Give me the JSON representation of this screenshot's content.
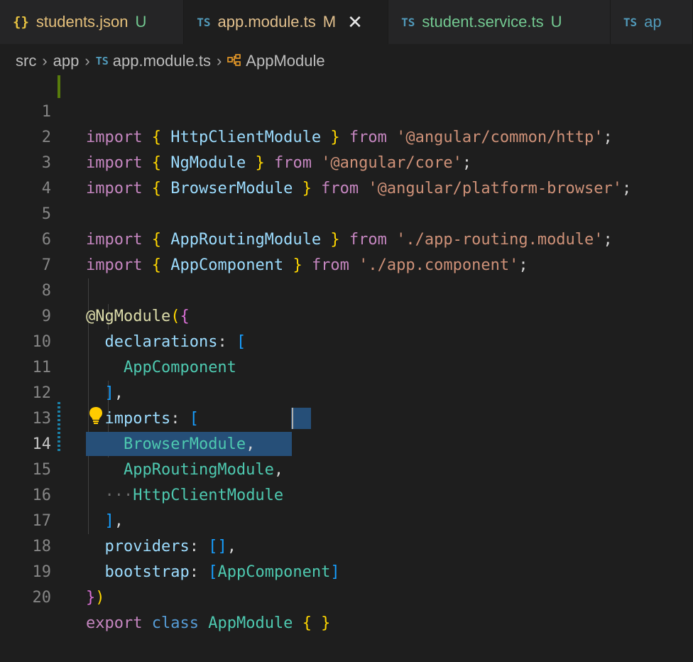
{
  "tabs": [
    {
      "icon": "{}",
      "name": "students.json",
      "status": "U"
    },
    {
      "icon": "TS",
      "name": "app.module.ts",
      "status": "M",
      "close": "✕"
    },
    {
      "icon": "TS",
      "name": "student.service.ts",
      "status": "U"
    },
    {
      "icon": "TS",
      "name": "ap"
    }
  ],
  "breadcrumb": {
    "parts": [
      "src",
      "app",
      "app.module.ts",
      "AppModule"
    ],
    "file_icon": "TS",
    "separator": "›"
  },
  "editor": {
    "line_numbers": [
      "1",
      "2",
      "3",
      "4",
      "5",
      "6",
      "7",
      "8",
      "9",
      "10",
      "11",
      "12",
      "13",
      "14",
      "15",
      "16",
      "17",
      "18",
      "19",
      "20"
    ],
    "tokens": {
      "import": "import",
      "from": "from",
      "lbrace": "{",
      "rbrace": "}",
      "semi": ";",
      "l1_id": "HttpClientModule",
      "l1_str": "'@angular/common/http'",
      "l2_id": "NgModule",
      "l2_str": "'@angular/core'",
      "l3_id": "BrowserModule",
      "l3_str": "'@angular/platform-browser'",
      "l5_id": "AppRoutingModule",
      "l5_str": "'./app-routing.module'",
      "l6_id": "AppComponent",
      "l6_str": "'./app.component'",
      "l8_at": "@NgModule",
      "l8_paren": "(",
      "l9_key": "declarations",
      "colon": ":",
      "lbrack": "[",
      "rbrack": "]",
      "comma": ",",
      "l10": "AppComponent",
      "l12_key": "imports",
      "l13": "BrowserModule",
      "l14": "AppRoutingModule",
      "l15_dots": "···",
      "l15": "HttpClientModule",
      "l17_key": "providers",
      "l17_val": "[]",
      "l18_key": "bootstrap",
      "l18_val": "AppComponent",
      "l19_rbrace": "}",
      "l19_paren": ")",
      "l20_export": "export",
      "l20_class": "class",
      "l20_name": "AppModule",
      "l20_braces": "{ }"
    }
  },
  "colors": {
    "keyword": "#c586c0",
    "class": "#4ec9b0",
    "string": "#ce9178",
    "identifier": "#9cdcfe",
    "selection": "#264f78"
  }
}
